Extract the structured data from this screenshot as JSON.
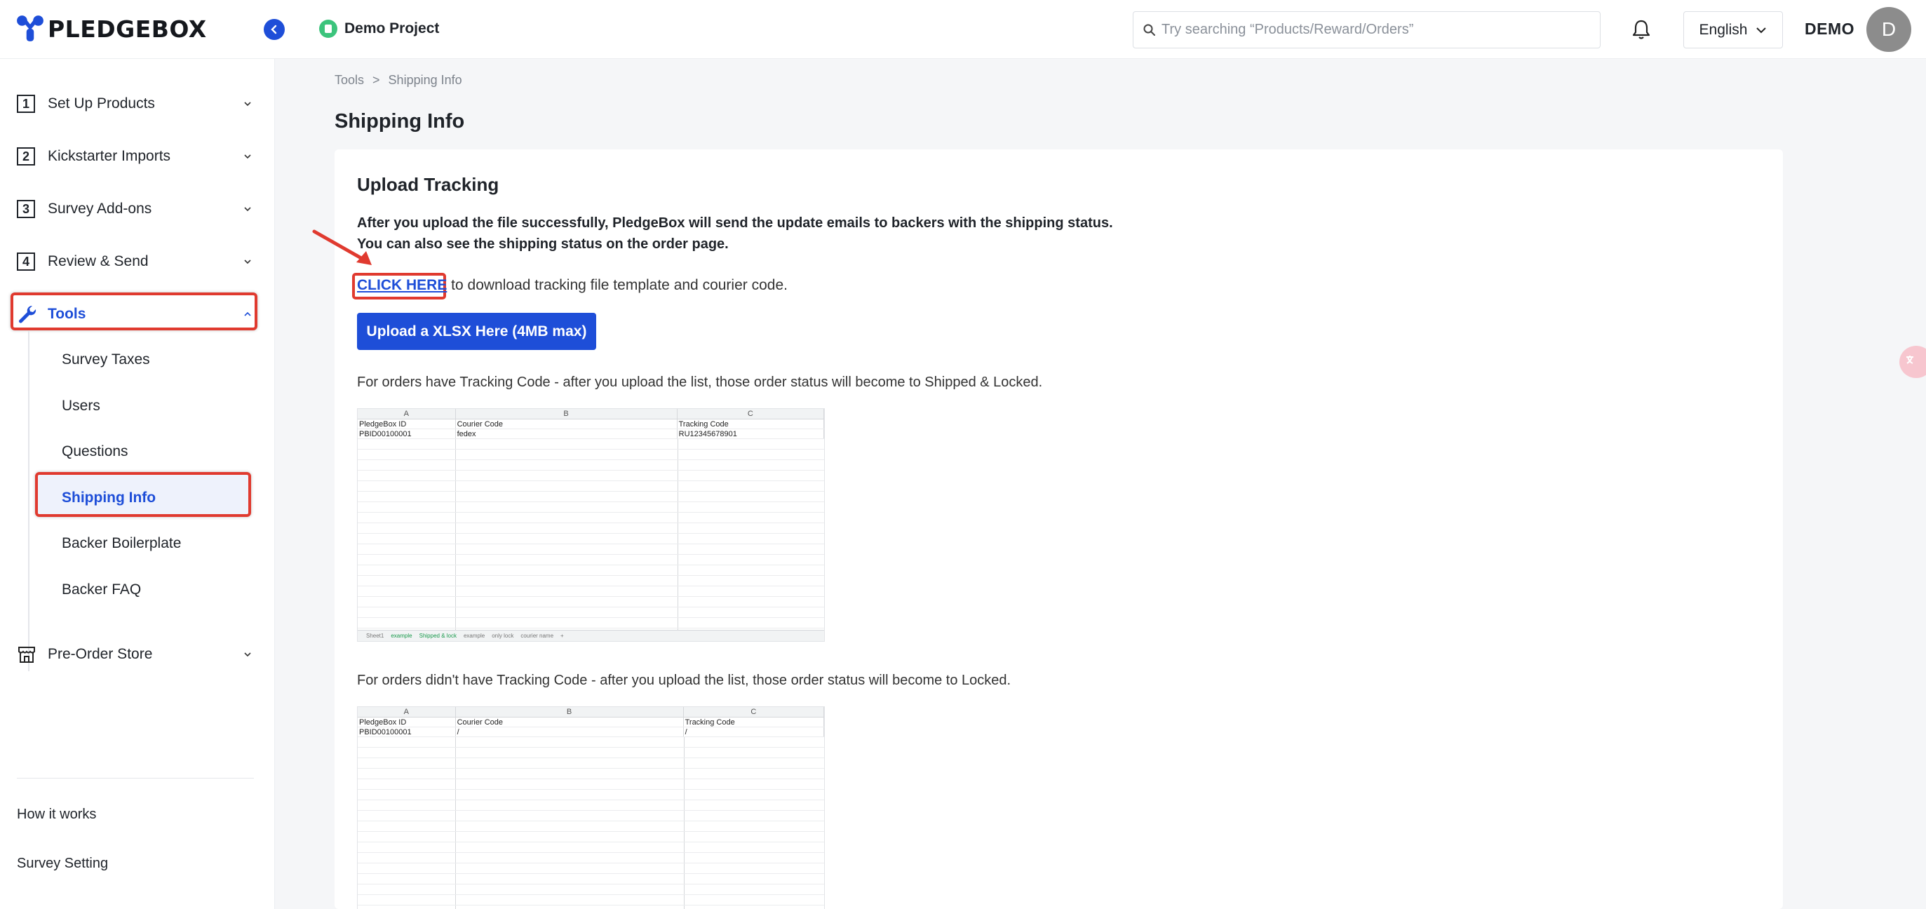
{
  "header": {
    "brand": "PLEDGEBOX",
    "project_name": "Demo Project",
    "search_placeholder": "Try searching “Products/Reward/Orders”",
    "language": "English",
    "user_label": "DEMO",
    "avatar_initial": "D"
  },
  "sidebar": {
    "items": [
      {
        "num": "1",
        "label": "Set Up Products"
      },
      {
        "num": "2",
        "label": "Kickstarter Imports"
      },
      {
        "num": "3",
        "label": "Survey Add-ons"
      },
      {
        "num": "4",
        "label": "Review & Send"
      },
      {
        "num": "",
        "label": "Tools"
      },
      {
        "num": "",
        "label": "Pre-Order Store"
      }
    ],
    "tools_sub": [
      "Survey Taxes",
      "Users",
      "Questions",
      "Shipping Info",
      "Backer Boilerplate",
      "Backer FAQ"
    ],
    "footer": [
      "How it works",
      "Survey Setting"
    ]
  },
  "breadcrumb": {
    "parent": "Tools",
    "separator": ">",
    "current": "Shipping Info"
  },
  "page_title": "Shipping Info",
  "card": {
    "title": "Upload Tracking",
    "info_line1": "After you upload the file successfully, PledgeBox will send the update emails to backers with the shipping status.",
    "info_line2": "You can also see the shipping status on the order page.",
    "click_here": "CLICK HERE",
    "click_rest": " to download tracking file template and courier code.",
    "upload_button": "Upload a XLSX Here (4MB max)",
    "desc1": "For orders have Tracking Code - after you upload the list, those order status will become to Shipped & Locked.",
    "desc2": "For orders didn't have Tracking Code - after you upload the list, those order status will become to Locked."
  },
  "sheet1": {
    "columns": [
      "A",
      "B",
      "C"
    ],
    "header_row": [
      "PledgeBox ID",
      "Courier Code",
      "Tracking Code"
    ],
    "data_row": [
      "PBID00100001",
      "fedex",
      "RU12345678901"
    ],
    "tabs": [
      "Sheet1",
      "example",
      "Shipped & lock",
      "example",
      "only lock",
      "courier name",
      "+"
    ]
  },
  "sheet2": {
    "columns": [
      "A",
      "B",
      "C"
    ],
    "header_row": [
      "PledgeBox ID",
      "Courier Code",
      "Tracking Code"
    ],
    "data_row": [
      "PBID00100001",
      "/",
      "/"
    ]
  }
}
